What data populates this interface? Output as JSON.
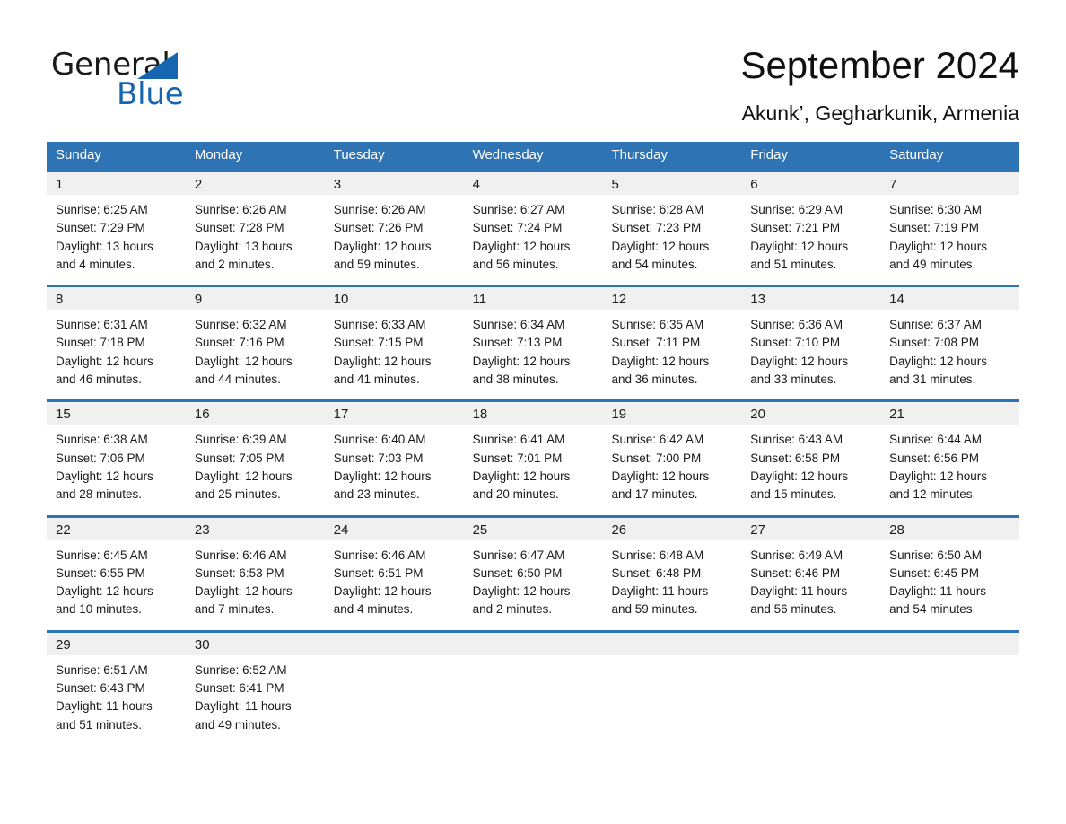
{
  "brand": {
    "name_part1": "General",
    "name_part2": "Blue",
    "triangle_icon": "blue-triangle-icon",
    "accent_color": "#1565b0"
  },
  "header": {
    "title": "September 2024",
    "subtitle": "Akunk’, Gegharkunik, Armenia"
  },
  "theme": {
    "header_blue": "#2e74b5",
    "date_band_gray": "#f0f0f0",
    "text_black": "#1a1a1a",
    "white": "#ffffff"
  },
  "calendar": {
    "weekday_headers": [
      "Sunday",
      "Monday",
      "Tuesday",
      "Wednesday",
      "Thursday",
      "Friday",
      "Saturday"
    ],
    "weeks": [
      {
        "numbers": [
          "1",
          "2",
          "3",
          "4",
          "5",
          "6",
          "7"
        ],
        "cells": [
          {
            "sunrise": "Sunrise: 6:25 AM",
            "sunset": "Sunset: 7:29 PM",
            "daylight1": "Daylight: 13 hours",
            "daylight2": "and 4 minutes."
          },
          {
            "sunrise": "Sunrise: 6:26 AM",
            "sunset": "Sunset: 7:28 PM",
            "daylight1": "Daylight: 13 hours",
            "daylight2": "and 2 minutes."
          },
          {
            "sunrise": "Sunrise: 6:26 AM",
            "sunset": "Sunset: 7:26 PM",
            "daylight1": "Daylight: 12 hours",
            "daylight2": "and 59 minutes."
          },
          {
            "sunrise": "Sunrise: 6:27 AM",
            "sunset": "Sunset: 7:24 PM",
            "daylight1": "Daylight: 12 hours",
            "daylight2": "and 56 minutes."
          },
          {
            "sunrise": "Sunrise: 6:28 AM",
            "sunset": "Sunset: 7:23 PM",
            "daylight1": "Daylight: 12 hours",
            "daylight2": "and 54 minutes."
          },
          {
            "sunrise": "Sunrise: 6:29 AM",
            "sunset": "Sunset: 7:21 PM",
            "daylight1": "Daylight: 12 hours",
            "daylight2": "and 51 minutes."
          },
          {
            "sunrise": "Sunrise: 6:30 AM",
            "sunset": "Sunset: 7:19 PM",
            "daylight1": "Daylight: 12 hours",
            "daylight2": "and 49 minutes."
          }
        ]
      },
      {
        "numbers": [
          "8",
          "9",
          "10",
          "11",
          "12",
          "13",
          "14"
        ],
        "cells": [
          {
            "sunrise": "Sunrise: 6:31 AM",
            "sunset": "Sunset: 7:18 PM",
            "daylight1": "Daylight: 12 hours",
            "daylight2": "and 46 minutes."
          },
          {
            "sunrise": "Sunrise: 6:32 AM",
            "sunset": "Sunset: 7:16 PM",
            "daylight1": "Daylight: 12 hours",
            "daylight2": "and 44 minutes."
          },
          {
            "sunrise": "Sunrise: 6:33 AM",
            "sunset": "Sunset: 7:15 PM",
            "daylight1": "Daylight: 12 hours",
            "daylight2": "and 41 minutes."
          },
          {
            "sunrise": "Sunrise: 6:34 AM",
            "sunset": "Sunset: 7:13 PM",
            "daylight1": "Daylight: 12 hours",
            "daylight2": "and 38 minutes."
          },
          {
            "sunrise": "Sunrise: 6:35 AM",
            "sunset": "Sunset: 7:11 PM",
            "daylight1": "Daylight: 12 hours",
            "daylight2": "and 36 minutes."
          },
          {
            "sunrise": "Sunrise: 6:36 AM",
            "sunset": "Sunset: 7:10 PM",
            "daylight1": "Daylight: 12 hours",
            "daylight2": "and 33 minutes."
          },
          {
            "sunrise": "Sunrise: 6:37 AM",
            "sunset": "Sunset: 7:08 PM",
            "daylight1": "Daylight: 12 hours",
            "daylight2": "and 31 minutes."
          }
        ]
      },
      {
        "numbers": [
          "15",
          "16",
          "17",
          "18",
          "19",
          "20",
          "21"
        ],
        "cells": [
          {
            "sunrise": "Sunrise: 6:38 AM",
            "sunset": "Sunset: 7:06 PM",
            "daylight1": "Daylight: 12 hours",
            "daylight2": "and 28 minutes."
          },
          {
            "sunrise": "Sunrise: 6:39 AM",
            "sunset": "Sunset: 7:05 PM",
            "daylight1": "Daylight: 12 hours",
            "daylight2": "and 25 minutes."
          },
          {
            "sunrise": "Sunrise: 6:40 AM",
            "sunset": "Sunset: 7:03 PM",
            "daylight1": "Daylight: 12 hours",
            "daylight2": "and 23 minutes."
          },
          {
            "sunrise": "Sunrise: 6:41 AM",
            "sunset": "Sunset: 7:01 PM",
            "daylight1": "Daylight: 12 hours",
            "daylight2": "and 20 minutes."
          },
          {
            "sunrise": "Sunrise: 6:42 AM",
            "sunset": "Sunset: 7:00 PM",
            "daylight1": "Daylight: 12 hours",
            "daylight2": "and 17 minutes."
          },
          {
            "sunrise": "Sunrise: 6:43 AM",
            "sunset": "Sunset: 6:58 PM",
            "daylight1": "Daylight: 12 hours",
            "daylight2": "and 15 minutes."
          },
          {
            "sunrise": "Sunrise: 6:44 AM",
            "sunset": "Sunset: 6:56 PM",
            "daylight1": "Daylight: 12 hours",
            "daylight2": "and 12 minutes."
          }
        ]
      },
      {
        "numbers": [
          "22",
          "23",
          "24",
          "25",
          "26",
          "27",
          "28"
        ],
        "cells": [
          {
            "sunrise": "Sunrise: 6:45 AM",
            "sunset": "Sunset: 6:55 PM",
            "daylight1": "Daylight: 12 hours",
            "daylight2": "and 10 minutes."
          },
          {
            "sunrise": "Sunrise: 6:46 AM",
            "sunset": "Sunset: 6:53 PM",
            "daylight1": "Daylight: 12 hours",
            "daylight2": "and 7 minutes."
          },
          {
            "sunrise": "Sunrise: 6:46 AM",
            "sunset": "Sunset: 6:51 PM",
            "daylight1": "Daylight: 12 hours",
            "daylight2": "and 4 minutes."
          },
          {
            "sunrise": "Sunrise: 6:47 AM",
            "sunset": "Sunset: 6:50 PM",
            "daylight1": "Daylight: 12 hours",
            "daylight2": "and 2 minutes."
          },
          {
            "sunrise": "Sunrise: 6:48 AM",
            "sunset": "Sunset: 6:48 PM",
            "daylight1": "Daylight: 11 hours",
            "daylight2": "and 59 minutes."
          },
          {
            "sunrise": "Sunrise: 6:49 AM",
            "sunset": "Sunset: 6:46 PM",
            "daylight1": "Daylight: 11 hours",
            "daylight2": "and 56 minutes."
          },
          {
            "sunrise": "Sunrise: 6:50 AM",
            "sunset": "Sunset: 6:45 PM",
            "daylight1": "Daylight: 11 hours",
            "daylight2": "and 54 minutes."
          }
        ]
      },
      {
        "numbers": [
          "29",
          "30",
          "",
          "",
          "",
          "",
          ""
        ],
        "cells": [
          {
            "sunrise": "Sunrise: 6:51 AM",
            "sunset": "Sunset: 6:43 PM",
            "daylight1": "Daylight: 11 hours",
            "daylight2": "and 51 minutes."
          },
          {
            "sunrise": "Sunrise: 6:52 AM",
            "sunset": "Sunset: 6:41 PM",
            "daylight1": "Daylight: 11 hours",
            "daylight2": "and 49 minutes."
          },
          {
            "sunrise": "",
            "sunset": "",
            "daylight1": "",
            "daylight2": ""
          },
          {
            "sunrise": "",
            "sunset": "",
            "daylight1": "",
            "daylight2": ""
          },
          {
            "sunrise": "",
            "sunset": "",
            "daylight1": "",
            "daylight2": ""
          },
          {
            "sunrise": "",
            "sunset": "",
            "daylight1": "",
            "daylight2": ""
          },
          {
            "sunrise": "",
            "sunset": "",
            "daylight1": "",
            "daylight2": ""
          }
        ]
      }
    ]
  }
}
